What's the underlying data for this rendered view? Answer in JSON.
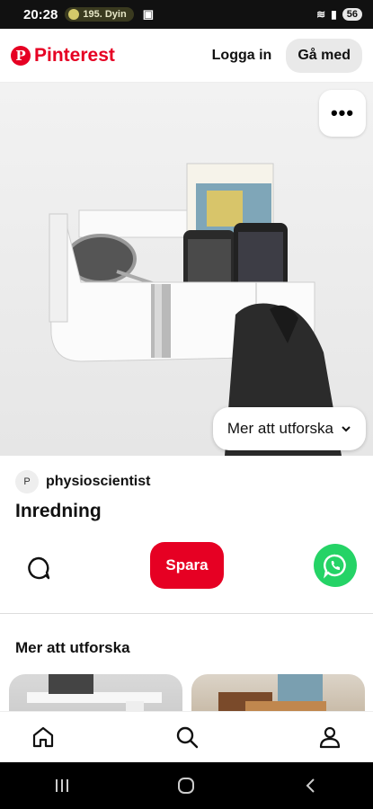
{
  "status_bar": {
    "time": "20:28",
    "media_text": "195. Dyin",
    "battery": "56"
  },
  "header": {
    "brand": "Pinterest",
    "login_label": "Logga in",
    "join_label": "Gå med"
  },
  "pin": {
    "author_initial": "P",
    "author_name": "physioscientist",
    "title": "Inredning",
    "explore_pill_label": "Mer att utforska",
    "save_label": "Spara"
  },
  "explore": {
    "heading": "Mer att utforska"
  },
  "colors": {
    "brand_red": "#e60023",
    "whatsapp_green": "#25d366"
  },
  "icons": [
    "pinterest-logo-icon",
    "more-icon",
    "chevron-down-icon",
    "comment-icon",
    "whatsapp-icon",
    "home-icon",
    "search-icon",
    "profile-icon",
    "recents-icon",
    "home-circle-icon",
    "back-icon"
  ]
}
